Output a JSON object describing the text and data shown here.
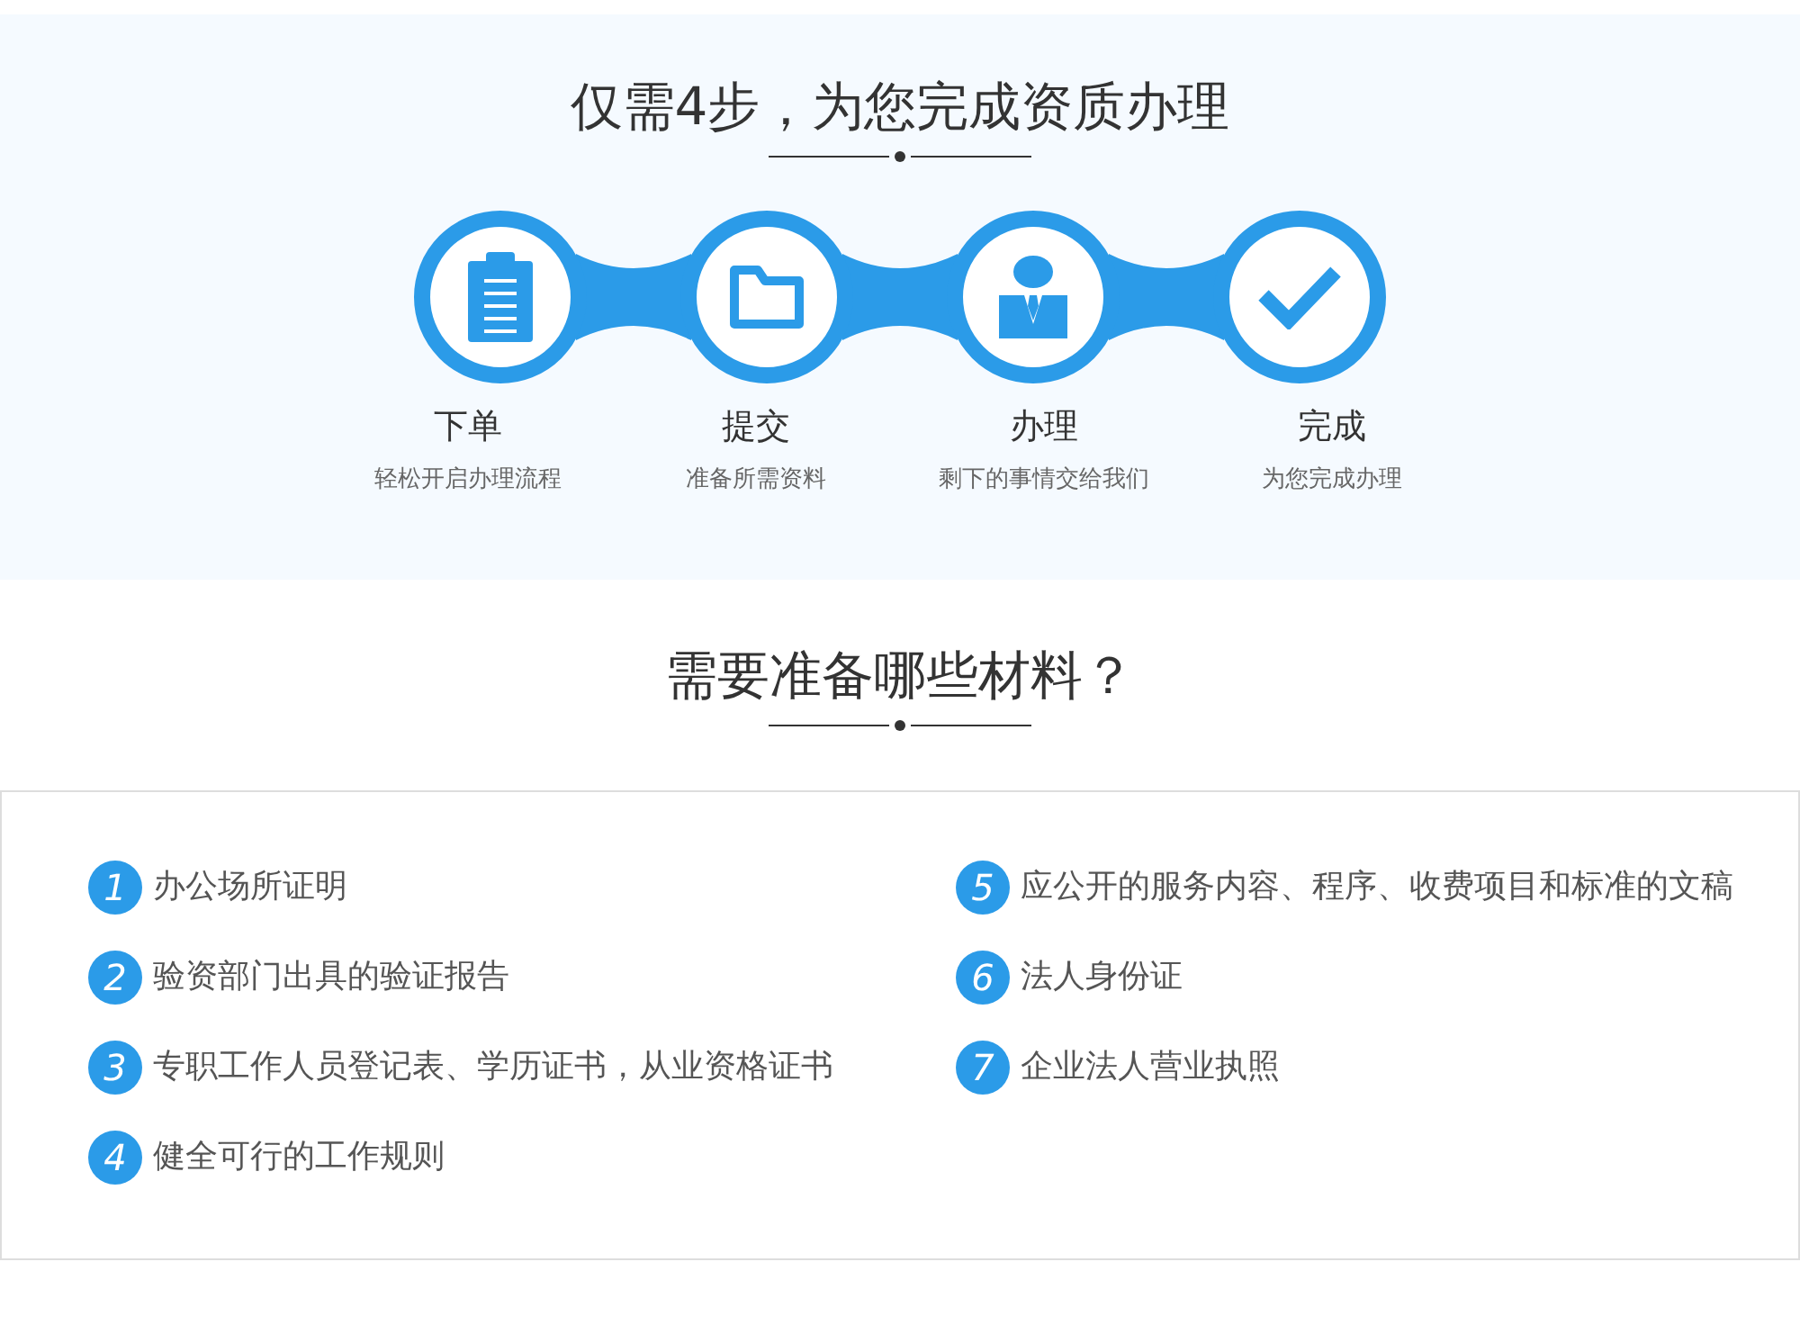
{
  "process": {
    "title": "仅需4步，为您完成资质办理",
    "steps": [
      {
        "name": "下单",
        "desc": "轻松开启办理流程"
      },
      {
        "name": "提交",
        "desc": "准备所需资料"
      },
      {
        "name": "办理",
        "desc": "剩下的事情交给我们"
      },
      {
        "name": "完成",
        "desc": "为您完成办理"
      }
    ]
  },
  "materials": {
    "title": "需要准备哪些材料？",
    "columns": [
      [
        {
          "number": "1",
          "text": "办公场所证明"
        },
        {
          "number": "2",
          "text": "验资部门出具的验证报告"
        },
        {
          "number": "3",
          "text": "专职工作人员登记表、学历证书，从业资格证书"
        },
        {
          "number": "4",
          "text": "健全可行的工作规则"
        }
      ],
      [
        {
          "number": "5",
          "text": "应公开的服务内容、程序、收费项目和标准的文稿"
        },
        {
          "number": "6",
          "text": "法人身份证"
        },
        {
          "number": "7",
          "text": "企业法人营业执照"
        }
      ]
    ]
  }
}
